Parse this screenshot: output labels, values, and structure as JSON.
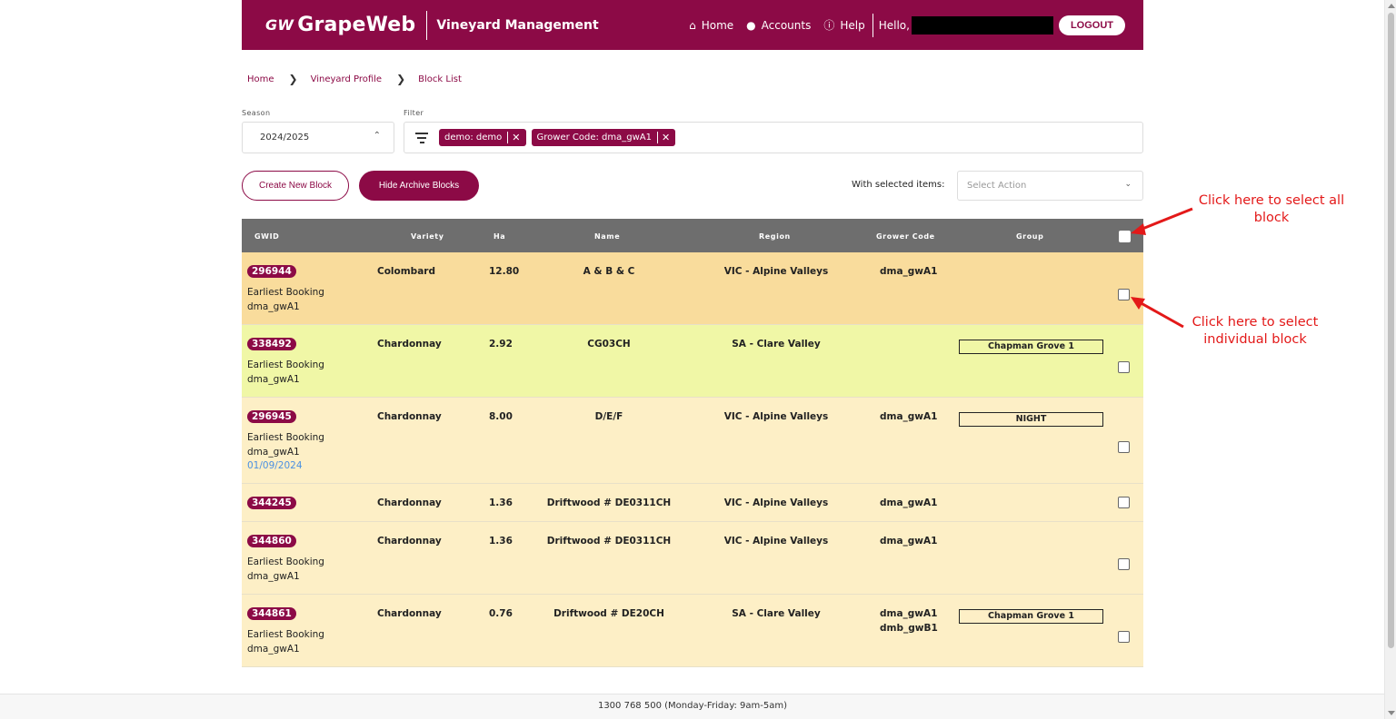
{
  "header": {
    "logo_mark": "GW",
    "logo_text": "GrapeWeb",
    "app_title": "Vineyard Management",
    "nav": {
      "home": "Home",
      "accounts": "Accounts",
      "help": "Help",
      "hello": "Hello,"
    },
    "logout": "LOGOUT"
  },
  "breadcrumb": [
    "Home",
    "Vineyard Profile",
    "Block List"
  ],
  "season": {
    "label": "Season",
    "value": "2024/2025"
  },
  "filter": {
    "label": "Filter",
    "chips": [
      "demo: demo",
      "Grower Code: dma_gwA1"
    ]
  },
  "actions": {
    "create": "Create New Block",
    "hide_archive": "Hide Archive Blocks",
    "with_selected": "With selected items:",
    "select_placeholder": "Select Action"
  },
  "table": {
    "columns": [
      "GWID",
      "Variety",
      "Ha",
      "Name",
      "Region",
      "Grower Code",
      "Group"
    ],
    "rows": [
      {
        "gwid": "296944",
        "variety": "Colombard",
        "ha": "12.80",
        "name": "A & B & C",
        "region": "VIC - Alpine Valleys",
        "grower": "dma_gwA1",
        "grower2": "",
        "group": "",
        "meta1": "Earliest Booking",
        "meta2": "dma_gwA1",
        "date": "",
        "color": "#f9dc9c"
      },
      {
        "gwid": "338492",
        "variety": "Chardonnay",
        "ha": "2.92",
        "name": "CG03CH",
        "region": "SA - Clare Valley",
        "grower": "",
        "grower2": "",
        "group": "Chapman Grove 1",
        "meta1": "Earliest Booking",
        "meta2": "dma_gwA1",
        "date": "",
        "color": "#f0f7a6"
      },
      {
        "gwid": "296945",
        "variety": "Chardonnay",
        "ha": "8.00",
        "name": "D/E/F",
        "region": "VIC - Alpine Valleys",
        "grower": "dma_gwA1",
        "grower2": "",
        "group": "NIGHT",
        "meta1": "Earliest Booking",
        "meta2": "dma_gwA1",
        "date": "01/09/2024",
        "color": "#fdefc6"
      },
      {
        "gwid": "344245",
        "variety": "Chardonnay",
        "ha": "1.36",
        "name": "Driftwood # DE0311CH",
        "region": "VIC - Alpine Valleys",
        "grower": "dma_gwA1",
        "grower2": "",
        "group": "",
        "meta1": "",
        "meta2": "",
        "date": "",
        "color": "#fdefc6"
      },
      {
        "gwid": "344860",
        "variety": "Chardonnay",
        "ha": "1.36",
        "name": "Driftwood # DE0311CH",
        "region": "VIC - Alpine Valleys",
        "grower": "dma_gwA1",
        "grower2": "",
        "group": "",
        "meta1": "Earliest Booking",
        "meta2": "dma_gwA1",
        "date": "",
        "color": "#fdefc6"
      },
      {
        "gwid": "344861",
        "variety": "Chardonnay",
        "ha": "0.76",
        "name": "Driftwood # DE20CH",
        "region": "SA - Clare Valley",
        "grower": "dma_gwA1",
        "grower2": "dmb_gwB1",
        "group": "Chapman Grove 1",
        "meta1": "Earliest Booking",
        "meta2": "dma_gwA1",
        "date": "",
        "color": "#fdefc6"
      }
    ]
  },
  "annotations": {
    "select_all": "Click here to select all block",
    "select_one": "Click here to select individual block"
  },
  "footer": "1300 768 500 (Monday-Friday: 9am-5am)",
  "colors": {
    "brand": "#8c0a46",
    "header_row": "#6e6e6e",
    "annotation": "#e31919"
  }
}
